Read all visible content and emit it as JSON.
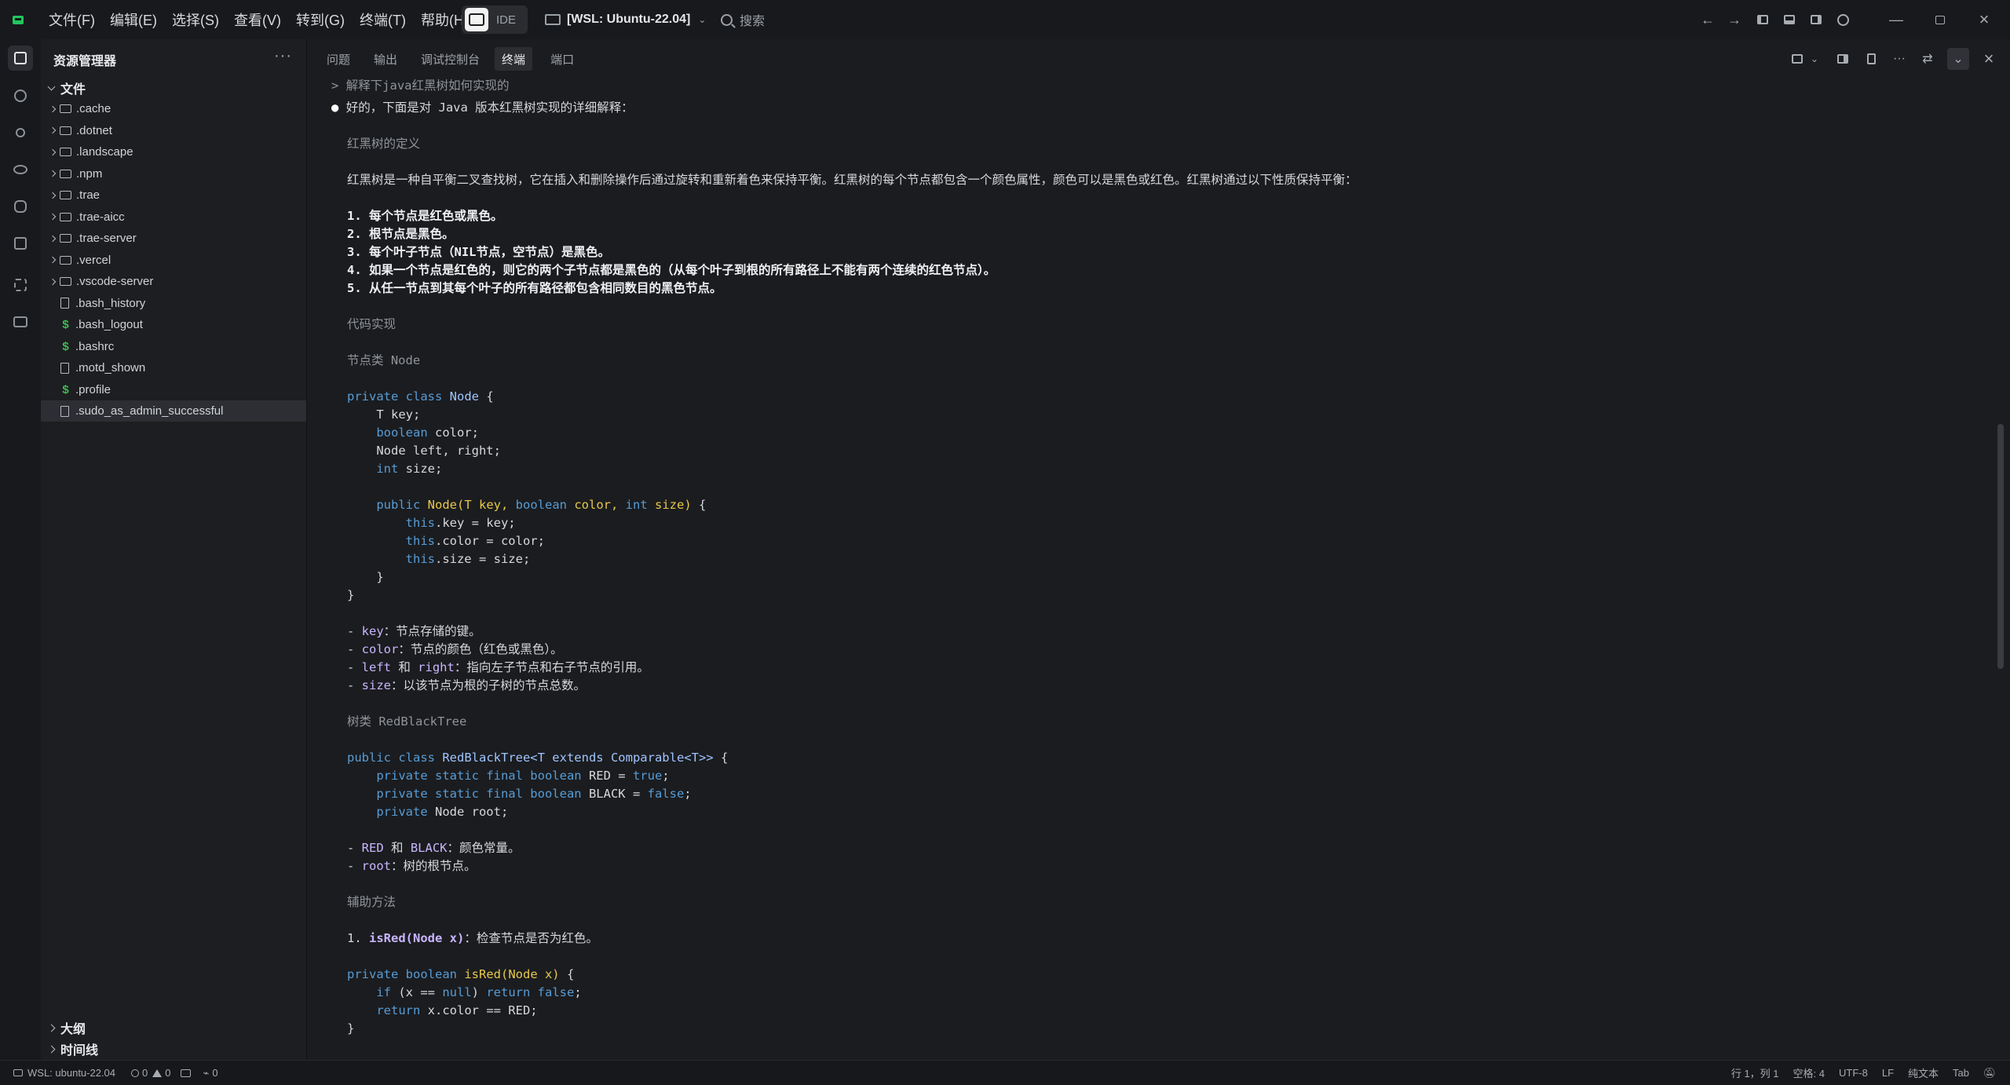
{
  "titlebar": {
    "menus": [
      "文件(F)",
      "编辑(E)",
      "选择(S)",
      "查看(V)",
      "转到(G)",
      "终端(T)",
      "帮助(H)"
    ],
    "mode_label": "IDE",
    "remote_label": "[WSL: Ubuntu-22.04]",
    "search_placeholder": "搜索"
  },
  "sidebar": {
    "title": "资源管理器",
    "folder_section": "文件",
    "items": [
      {
        "name": ".cache",
        "type": "folder"
      },
      {
        "name": ".dotnet",
        "type": "folder"
      },
      {
        "name": ".landscape",
        "type": "folder"
      },
      {
        "name": ".npm",
        "type": "folder"
      },
      {
        "name": ".trae",
        "type": "folder"
      },
      {
        "name": ".trae-aicc",
        "type": "folder"
      },
      {
        "name": ".trae-server",
        "type": "folder"
      },
      {
        "name": ".vercel",
        "type": "folder"
      },
      {
        "name": ".vscode-server",
        "type": "folder"
      },
      {
        "name": ".bash_history",
        "type": "file"
      },
      {
        "name": ".bash_logout",
        "type": "shell"
      },
      {
        "name": ".bashrc",
        "type": "shell"
      },
      {
        "name": ".motd_shown",
        "type": "file"
      },
      {
        "name": ".profile",
        "type": "shell"
      },
      {
        "name": ".sudo_as_admin_successful",
        "type": "file"
      }
    ],
    "outline_label": "大纲",
    "timeline_label": "时间线"
  },
  "panel": {
    "tabs": [
      "问题",
      "输出",
      "调试控制台",
      "终端",
      "端口"
    ],
    "active_tab": "终端"
  },
  "terminal": {
    "prompt": "> 解释下java红黑树如何实现的",
    "answer_intro": "好的，下面是对 Java 版本红黑树实现的详细解释：",
    "h_definition": "红黑树的定义",
    "definition": "红黑树是一种自平衡二叉查找树，它在插入和删除操作后通过旋转和重新着色来保持平衡。红黑树的每个节点都包含一个颜色属性，颜色可以是黑色或红色。红黑树通过以下性质保持平衡：",
    "rules": [
      "1. 每个节点是红色或黑色。",
      "2. 根节点是黑色。",
      "3. 每个叶子节点（NIL节点，空节点）是黑色。",
      "4. 如果一个节点是红色的，则它的两个子节点都是黑色的（从每个叶子到根的所有路径上不能有两个连续的红色节点）。",
      "5. 从任一节点到其每个叶子的所有路径都包含相同数目的黑色节点。"
    ],
    "h_impl": "代码实现",
    "h_node": "节点类 Node",
    "node_code": {
      "l1_kw": "private class",
      "l1_ty": "Node",
      "l1_rest": " {",
      "l2": "    T key;",
      "l3_kw": "boolean",
      "l3_rest": " color;",
      "l4": "    Node left, right;",
      "l5_kw": "int",
      "l5_rest": " size;",
      "ctor_kw": "public",
      "ctor_fn": "Node(",
      "ctor_a1": "T key, ",
      "ctor_kw2": "boolean",
      "ctor_a2": " color, ",
      "ctor_kw3": "int",
      "ctor_a3": " size)",
      "ctor_end": " {",
      "b1_kw": "this",
      "b1_rest": ".key = key;",
      "b2_kw": "this",
      "b2_rest": ".color = color;",
      "b3_kw": "this",
      "b3_rest": ".size = size;",
      "close_inner": "    }",
      "close_outer": "}"
    },
    "fields": [
      {
        "prefix": "- ",
        "name": "key",
        "desc": "：节点存储的键。"
      },
      {
        "prefix": "- ",
        "name": "color",
        "desc": "：节点的颜色（红色或黑色）。"
      },
      {
        "prefix": "- ",
        "name": "left",
        "mid": " 和 ",
        "name2": "right",
        "desc": "：指向左子节点和右子节点的引用。"
      },
      {
        "prefix": "- ",
        "name": "size",
        "desc": "：以该节点为根的子树的节点总数。"
      }
    ],
    "h_tree": "树类 RedBlackTree",
    "tree_code": {
      "l1_kw": "public class",
      "l1_ty": "RedBlackTree<T extends Comparable<T>>",
      "l1_rest": " {",
      "l2_kw": "private static final boolean",
      "l2_mid": " RED = ",
      "l2_val": "true",
      "l2_end": ";",
      "l3_kw": "private static final boolean",
      "l3_mid": " BLACK = ",
      "l3_val": "false",
      "l3_end": ";",
      "l4_kw": "private",
      "l4_rest": " Node root;"
    },
    "tree_fields": [
      {
        "prefix": "- ",
        "name": "RED",
        "mid": " 和 ",
        "name2": "BLACK",
        "desc": "：颜色常量。"
      },
      {
        "prefix": "- ",
        "name": "root",
        "desc": "：树的根节点。"
      }
    ],
    "h_helpers": "辅助方法",
    "helper_1_prefix": "1. ",
    "helper_1_sig": "isRed(Node x)",
    "helper_1_desc": "：检查节点是否为红色。",
    "isred_code": {
      "l1_kw": "private boolean",
      "l1_fn": "isRed(Node x)",
      "l1_rest": " {",
      "l2_kw": "if",
      "l2_a": " (x == ",
      "l2_null": "null",
      "l2_b": ") ",
      "l2_ret": "return",
      "l2_false": " false",
      "l2_end": ";",
      "l3_ret": "return",
      "l3_rest": " x.color == RED;",
      "l4": "}"
    }
  },
  "status": {
    "remote": "WSL: ubuntu-22.04",
    "errors": "0",
    "warnings": "0",
    "ports": "0",
    "position": "行 1，列 1",
    "spaces": "空格: 4",
    "encoding": "UTF-8",
    "eol": "LF",
    "language": "纯文本",
    "tab": "Tab"
  }
}
